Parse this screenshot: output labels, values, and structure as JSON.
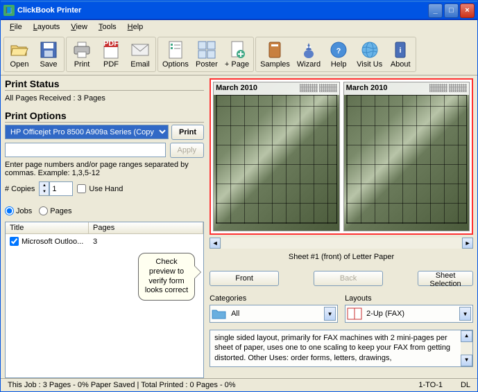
{
  "titlebar": {
    "title": "ClickBook Printer"
  },
  "menus": {
    "file": "File",
    "layouts": "Layouts",
    "view": "View",
    "tools": "Tools",
    "help": "Help"
  },
  "toolbar": {
    "open": "Open",
    "save": "Save",
    "print": "Print",
    "pdf": "PDF",
    "email": "Email",
    "options": "Options",
    "poster": "Poster",
    "addpage": "+ Page",
    "samples": "Samples",
    "wizard": "Wizard",
    "help": "Help",
    "visit": "Visit Us",
    "about": "About"
  },
  "printStatus": {
    "heading": "Print Status",
    "text": "All Pages Received : 3 Pages"
  },
  "printOptions": {
    "heading": "Print Options",
    "printer": "HP Officejet Pro 8500 A909a Series (Copy",
    "printBtn": "Print",
    "rangeValue": "",
    "applyBtn": "Apply",
    "hint": "Enter page numbers and/or page ranges separated by commas.  Example:  1,3,5-12",
    "copiesLabel": "# Copies",
    "copiesValue": "1",
    "useHand": "Use Hand"
  },
  "callout": "Check preview to verify form looks correct",
  "radios": {
    "jobs": "Jobs",
    "pages": "Pages"
  },
  "list": {
    "colTitle": "Title",
    "colPages": "Pages",
    "items": [
      {
        "title": "Microsoft Outloo...",
        "pages": "3",
        "checked": true
      }
    ]
  },
  "preview": {
    "month": "March 2010",
    "caption": "Sheet #1 (front) of Letter Paper",
    "front": "Front",
    "back": "Back",
    "sheetSelection": "Sheet Selection"
  },
  "categories": {
    "label": "Categories",
    "value": "All",
    "layoutsLabel": "Layouts",
    "layoutsValue": "2-Up (FAX)"
  },
  "description": "single sided layout, primarily for FAX machines with 2 mini-pages per sheet of paper, uses one to one scaling to keep your FAX from getting distorted. Other Uses: order forms, letters, drawings,",
  "statusbar": {
    "left": "This Job : 3 Pages - 0% Paper Saved | Total Printed : 0 Pages - 0%",
    "scale": "1-TO-1",
    "dl": "DL"
  }
}
